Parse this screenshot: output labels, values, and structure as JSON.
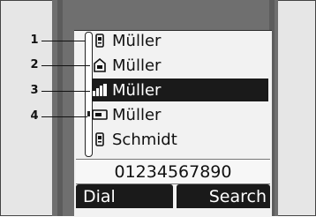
{
  "callouts": [
    "1",
    "2",
    "3",
    "4"
  ],
  "contacts": [
    {
      "icon": "mobile-phone-icon",
      "name": "Müller",
      "selected": false
    },
    {
      "icon": "home-phone-icon",
      "name": "Müller",
      "selected": false
    },
    {
      "icon": "office-phone-icon",
      "name": "Müller",
      "selected": true
    },
    {
      "icon": "fax-icon",
      "name": "Müller",
      "selected": false
    },
    {
      "icon": "mobile-phone-icon",
      "name": "Schmidt",
      "selected": false
    }
  ],
  "number": "01234567890",
  "softkeys": {
    "left": "Dial",
    "right": "Search"
  }
}
